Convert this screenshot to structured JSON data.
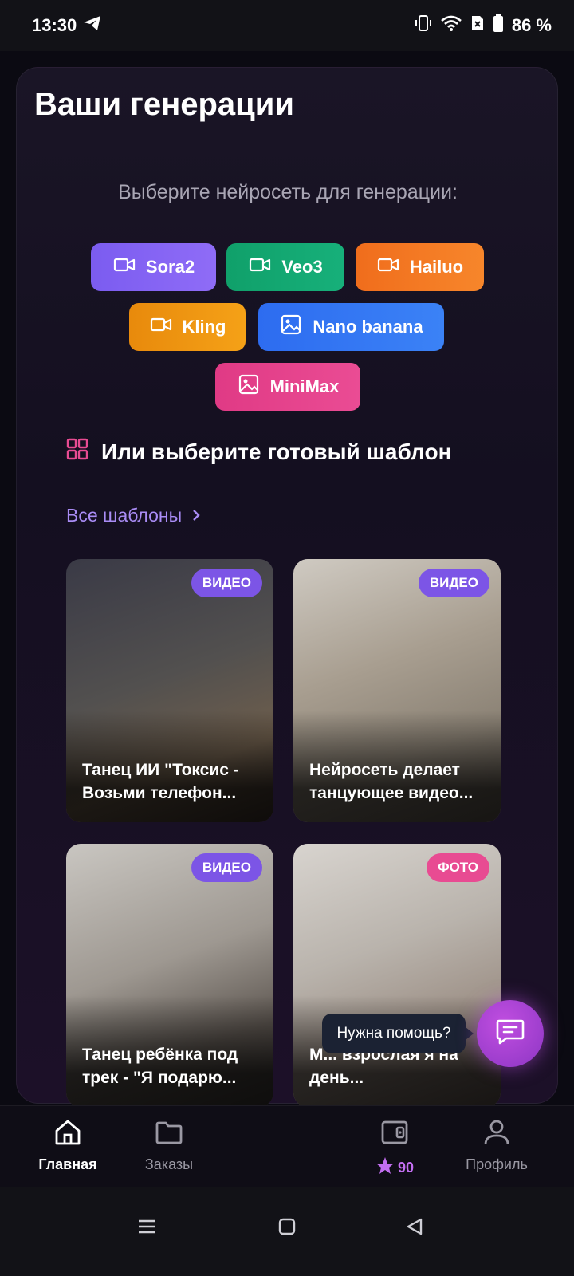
{
  "status_bar": {
    "time": "13:30",
    "battery": "86 %"
  },
  "main": {
    "title": "Ваши генерации",
    "subtitle": "Выберите нейросеть для генерации:",
    "models": [
      {
        "label": "Sora2",
        "icon": "video-icon",
        "color": "#7b5cf0"
      },
      {
        "label": "Veo3",
        "icon": "video-icon",
        "color": "#10a06a"
      },
      {
        "label": "Hailuo",
        "icon": "video-icon",
        "color": "#f06d1c"
      },
      {
        "label": "Kling",
        "icon": "video-icon",
        "color": "#e88a0c"
      },
      {
        "label": "Nano banana",
        "icon": "image-icon",
        "color": "#2d6cf0"
      },
      {
        "label": "MiniMax",
        "icon": "image-icon",
        "color": "#e03a85"
      }
    ],
    "templates_heading": "Или выберите готовый шаблон",
    "all_templates_link": "Все шаблоны",
    "templates": [
      {
        "badge": "ВИДЕО",
        "title": "Танец ИИ \"Токсис - Возьми телефон..."
      },
      {
        "badge": "ВИДЕО",
        "title": "Нейросеть делает танцующее видео..."
      },
      {
        "badge": "ВИДЕО",
        "title": "Танец ребёнка под трек - \"Я подарю..."
      },
      {
        "badge": "ФОТО",
        "title": "М... взрослая я на день..."
      }
    ]
  },
  "help_bubble": "Нужна помощь?",
  "bottom_nav": {
    "home": "Главная",
    "orders": "Заказы",
    "stars": "90",
    "profile": "Профиль"
  },
  "colors": {
    "accent": "#7c55e6",
    "photo_badge": "#e84b92",
    "link": "#a98cf5",
    "stars": "#c26ef0"
  }
}
